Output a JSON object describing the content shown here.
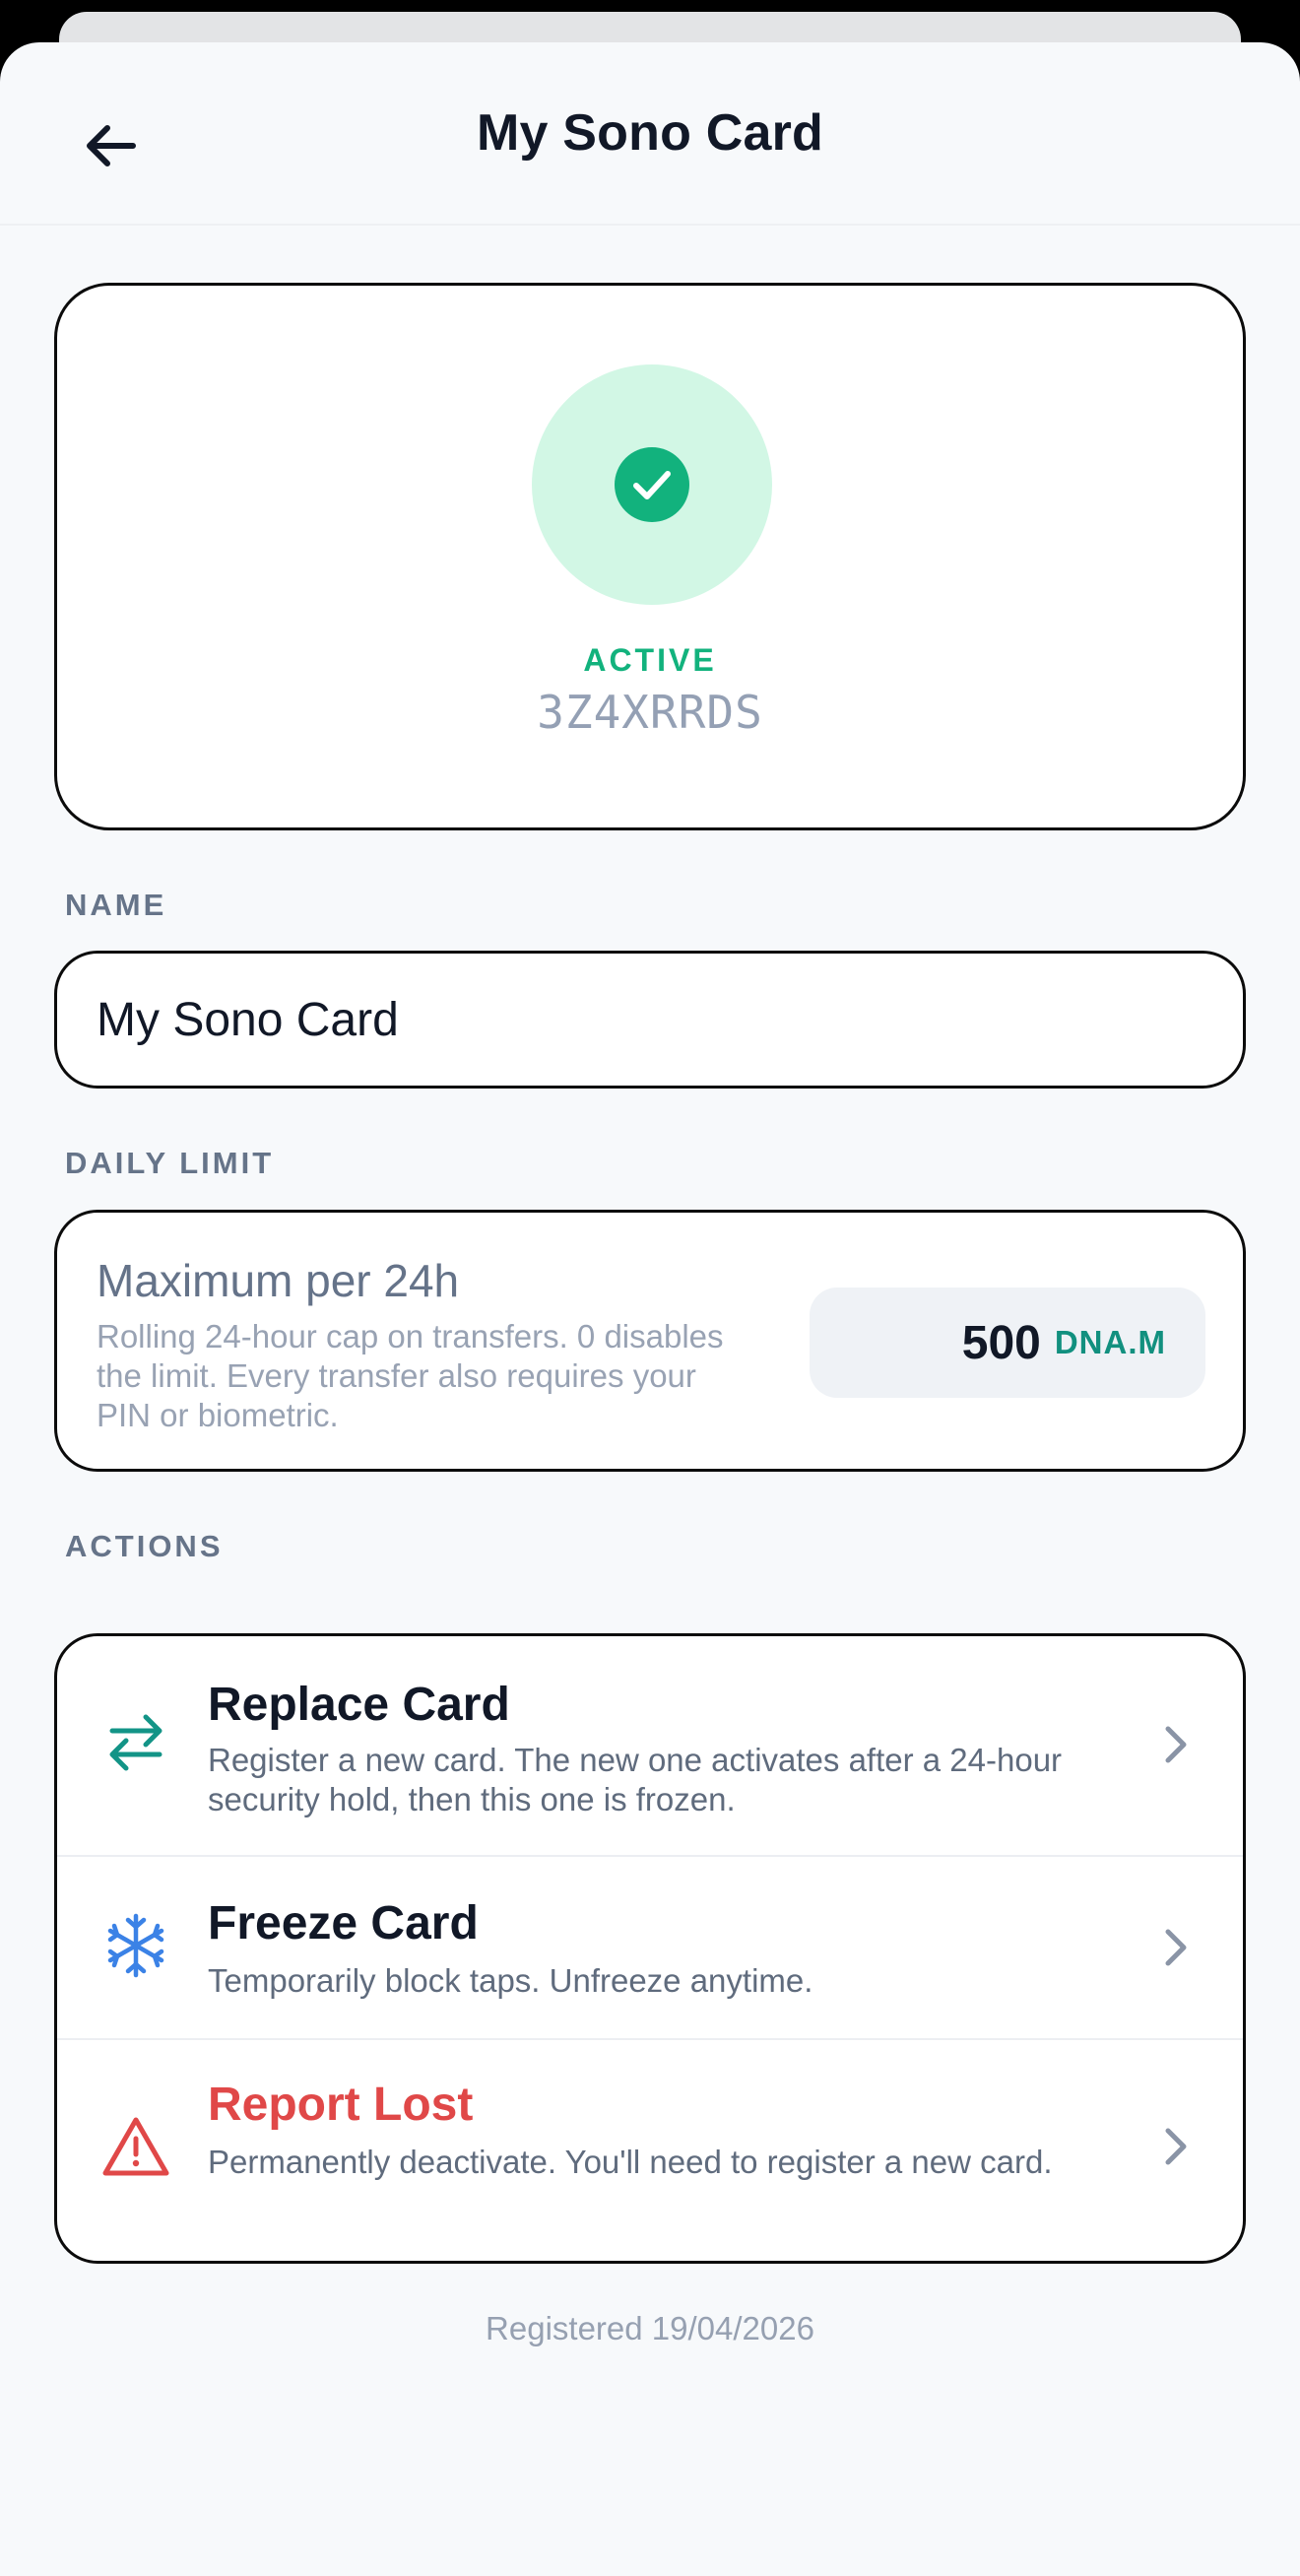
{
  "header": {
    "title": "My Sono Card"
  },
  "status": {
    "state": "ACTIVE",
    "card_id": "3Z4XRRDS",
    "accent_color": "#12b27d",
    "icon": "check-circle-icon"
  },
  "name_section": {
    "label": "NAME",
    "value": "My Sono Card"
  },
  "limit_section": {
    "label": "DAILY LIMIT",
    "title": "Maximum per 24h",
    "description": "Rolling 24-hour cap on transfers. 0 disables the limit. Every transfer also requires your PIN or biometric.",
    "value": "500",
    "unit": "DNA.M"
  },
  "actions_section": {
    "label": "ACTIONS",
    "items": [
      {
        "title": "Replace Card",
        "description": "Register a new card. The new one activates after a 24-hour security hold, then this one is frozen.",
        "icon": "swap-arrows-icon",
        "icon_color": "#139487"
      },
      {
        "title": "Freeze Card",
        "description": "Temporarily block taps. Unfreeze anytime.",
        "icon": "snowflake-icon",
        "icon_color": "#3b82e6"
      },
      {
        "title": "Report Lost",
        "description": "Permanently deactivate. You'll need to register a new card.",
        "icon": "warning-triangle-icon",
        "icon_color": "#e04848"
      }
    ]
  },
  "footer": {
    "registered_text": "Registered 19/04/2026"
  }
}
